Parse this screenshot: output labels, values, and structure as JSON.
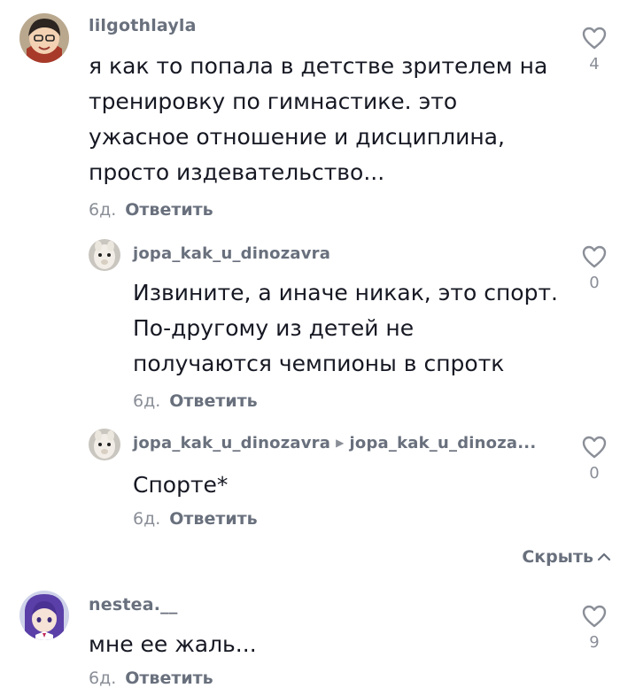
{
  "comments": [
    {
      "username": "lilgothlayla",
      "avatar": "anime-avatar-red",
      "lines": [
        "я как то попала в детстве зрителем на",
        "тренировку по гимнастике. это",
        "ужасное отношение и дисциплина,",
        "просто издевательство..."
      ],
      "time": "6д.",
      "reply_label": "Ответить",
      "likes": "4",
      "replies": [
        {
          "username": "jopa_kak_u_dinozavra",
          "avatar": "alpaca-avatar",
          "lines": [
            "Извините, а иначе никак, это спорт.",
            "По-другому из детей не",
            "получаются чемпионы в спротк"
          ],
          "time": "6д.",
          "reply_label": "Ответить",
          "likes": "0"
        },
        {
          "username": "jopa_kak_u_dinozavra",
          "reply_to": "jopa_kak_u_dinoza...",
          "avatar": "alpaca-avatar",
          "lines": [
            "Спорте*"
          ],
          "time": "6д.",
          "reply_label": "Ответить",
          "likes": "0"
        }
      ]
    },
    {
      "username": "nestea.__",
      "avatar": "anime-avatar-purple",
      "lines": [
        "мне ее жаль..."
      ],
      "time": "6д.",
      "reply_label": "Ответить",
      "likes": "9"
    }
  ],
  "hide_replies_label": "Скрыть",
  "colors": {
    "text": "#161823",
    "username": "#69707d",
    "secondary": "#8a8e97"
  }
}
